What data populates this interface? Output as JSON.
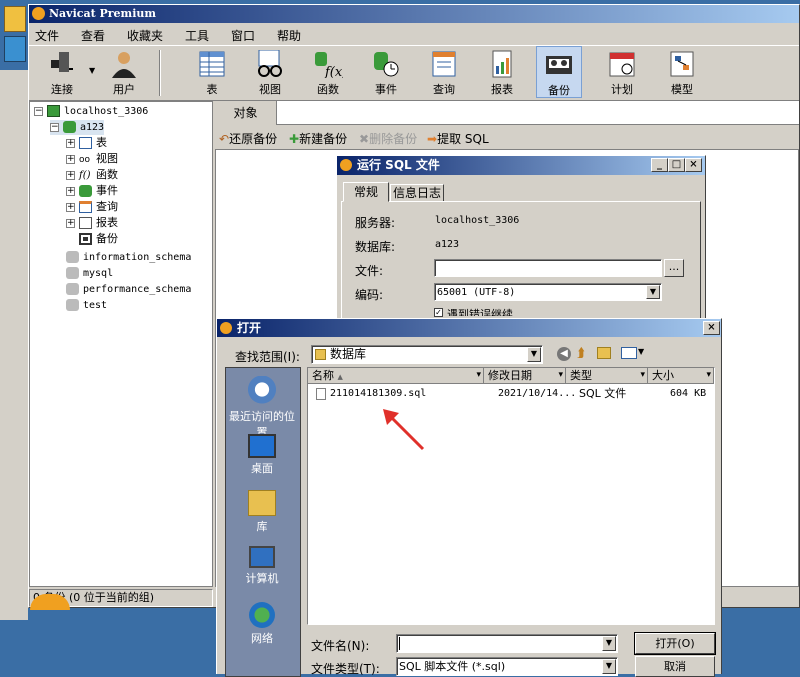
{
  "app": {
    "title": "Navicat Premium",
    "menu": [
      "文件",
      "查看",
      "收藏夹",
      "工具",
      "窗口",
      "帮助"
    ],
    "toolbar": [
      "连接",
      "用户",
      "表",
      "视图",
      "函数",
      "事件",
      "查询",
      "报表",
      "备份",
      "计划",
      "模型"
    ],
    "active_tool": "备份"
  },
  "tree": {
    "connection": "localhost_3306",
    "database": "a123",
    "children": [
      "表",
      "视图",
      "函数",
      "事件",
      "查询",
      "报表",
      "备份"
    ],
    "other_dbs": [
      "information_schema",
      "mysql",
      "performance_schema",
      "test"
    ]
  },
  "status": "0 备份 (0 位于当前的组)",
  "main": {
    "tab": "对象",
    "actions": [
      "还原备份",
      "新建备份",
      "删除备份",
      "提取 SQL"
    ]
  },
  "run_sql": {
    "title": "运行 SQL 文件",
    "tabs": [
      "常规",
      "信息日志"
    ],
    "server_label": "服务器:",
    "server_value": "localhost_3306",
    "db_label": "数据库:",
    "db_value": "a123",
    "file_label": "文件:",
    "file_value": "",
    "browse": "...",
    "encoding_label": "编码:",
    "encoding_value": "65001 (UTF-8)",
    "partial_option": "遇到错误继续"
  },
  "open_dialog": {
    "title": "打开",
    "lookin_label": "查找范围(I):",
    "lookin_value": "数据库",
    "places": [
      "最近访问的位置",
      "桌面",
      "库",
      "计算机",
      "网络"
    ],
    "columns": [
      "名称",
      "修改日期",
      "类型",
      "大小"
    ],
    "files": [
      {
        "name": "211014181309.sql",
        "date": "2021/10/14...",
        "type": "SQL 文件",
        "size": "604 KB"
      }
    ],
    "filename_label": "文件名(N):",
    "filename_value": "",
    "filetype_label": "文件类型(T):",
    "filetype_value": "SQL 脚本文件 (*.sql)",
    "open_btn": "打开(O)",
    "cancel_btn": "取消"
  },
  "colors": {
    "desktop": "#3a6ea5",
    "titlebar": "#0a246a",
    "face": "#d4d0c8",
    "arrow": "#e0302a"
  }
}
